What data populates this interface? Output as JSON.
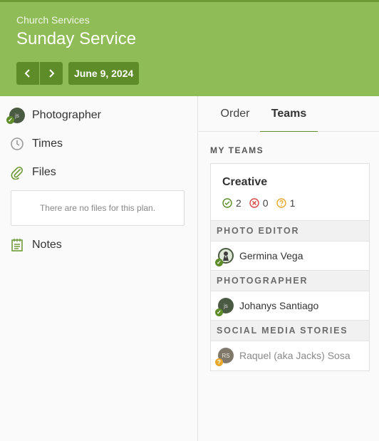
{
  "header": {
    "subtitle": "Church Services",
    "title": "Sunday Service",
    "date": "June 9, 2024"
  },
  "left": {
    "items": [
      {
        "label": "Photographer",
        "icon": "avatar-js"
      },
      {
        "label": "Times",
        "icon": "clock-icon"
      },
      {
        "label": "Files",
        "icon": "paperclip-icon"
      },
      {
        "label": "Notes",
        "icon": "notes-icon"
      }
    ],
    "files_empty": "There are no files for this plan.",
    "avatar_initials": "js"
  },
  "tabs": {
    "order": "Order",
    "teams": "Teams"
  },
  "my_teams_label": "MY TEAMS",
  "team": {
    "name": "Creative",
    "confirmed": "2",
    "declined": "0",
    "pending": "1",
    "sections": [
      {
        "title": "PHOTO EDITOR",
        "people": [
          {
            "name": "Germina Vega",
            "status": "confirmed"
          }
        ]
      },
      {
        "title": "PHOTOGRAPHER",
        "people": [
          {
            "name": "Johanys Santiago",
            "initials": "js",
            "status": "confirmed"
          }
        ]
      },
      {
        "title": "SOCIAL MEDIA STORIES",
        "people": [
          {
            "name": "Raquel (aka Jacks) Sosa",
            "initials": "RS",
            "status": "pending"
          }
        ]
      }
    ]
  },
  "colors": {
    "header_bg": "#8fbc57",
    "button_bg": "#5d8c29",
    "confirmed": "#5d8c29",
    "declined": "#d64545",
    "pending": "#e8a92b"
  }
}
